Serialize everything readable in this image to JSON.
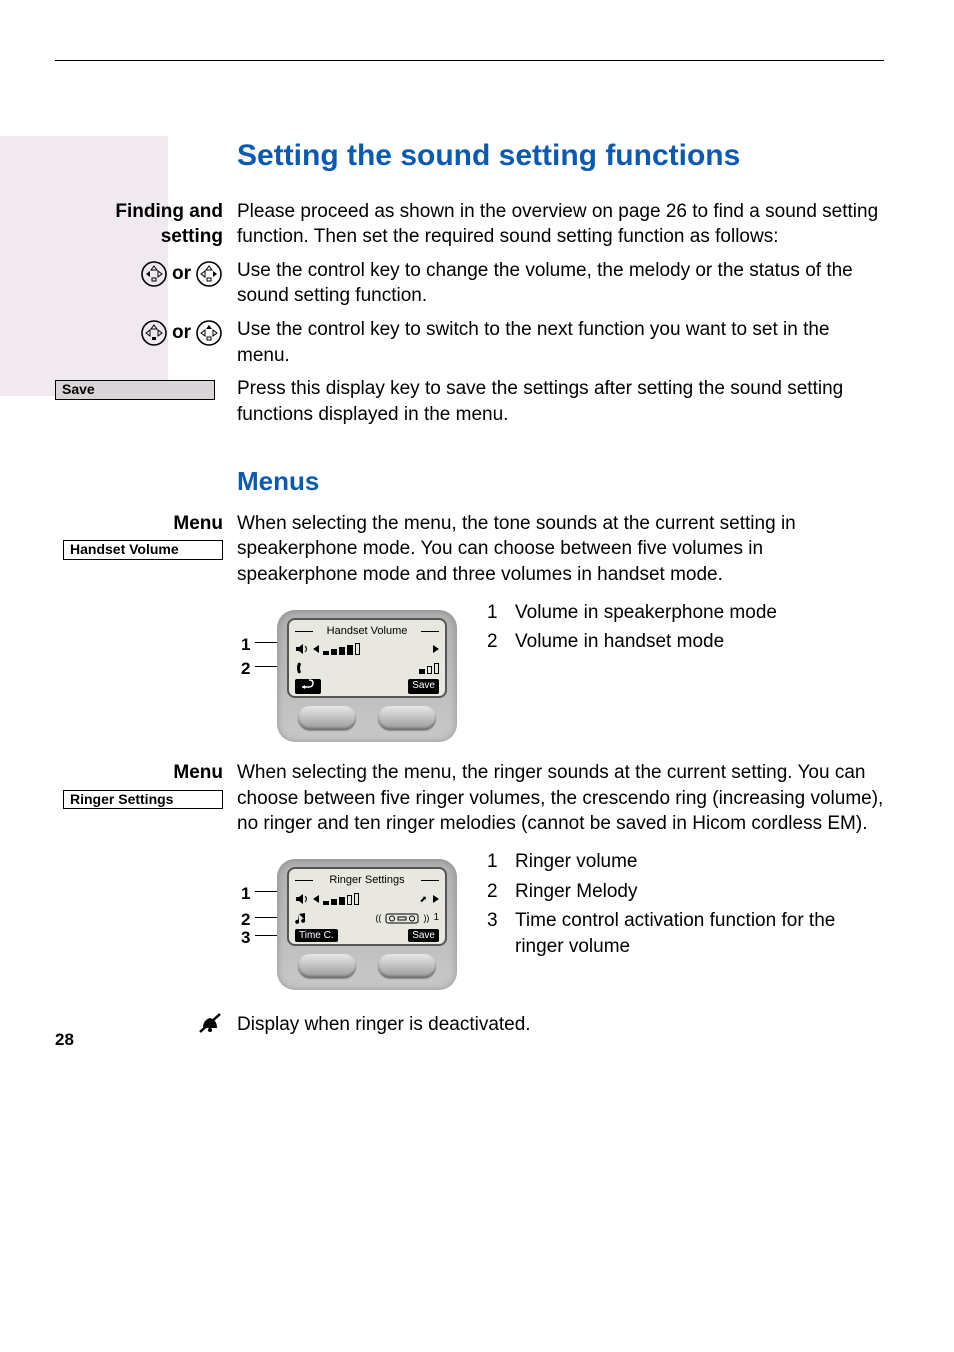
{
  "pageNumber": "28",
  "title": "Setting the sound setting functions",
  "findingLabel": "Finding and setting",
  "or": "or",
  "findingBody": "Please proceed as shown in the overview on page 26 to find a sound setting function. Then set the required sound setting function as follows:",
  "controlBody1": "Use the control key to change the volume, the melody or the status of the sound setting function.",
  "controlBody2": "Use the control key to switch to the next function you want to set in the menu.",
  "saveKey": "Save",
  "saveBody": "Press this display key to save the settings after setting the sound setting functions displayed in the menu.",
  "menusHeading": "Menus",
  "menuLabel": "Menu",
  "handsetVolumeKey": "Handset Volume",
  "handsetVolumeBody": "When selecting the menu, the tone sounds at the current setting in speakerphone mode. You can choose between five volumes in speakerphone mode and three volumes in handset mode.",
  "handsetScreenTitle": "Handset Volume",
  "softSave": "Save",
  "legend1": {
    "n1": "1",
    "t1": "Volume in speakerphone mode",
    "n2": "2",
    "t2": "Volume in handset mode"
  },
  "ringerSettingsKey": "Ringer Settings",
  "ringerBody": "When selecting the menu, the ringer sounds at the current setting. You can choose between five ringer volumes, the crescendo ring (increasing volume), no ringer and ten ringer melodies (cannot be saved in Hicom cordless EM).",
  "ringerScreenTitle": "Ringer Settings",
  "softTimeC": "Time C.",
  "legend2": {
    "n1": "1",
    "t1": "Ringer volume",
    "n2": "2",
    "t2": "Ringer Melody",
    "n3": "3",
    "t3": "Time control activation function for the ringer volume"
  },
  "ringerOffBody": "Display when ringer is deactivated."
}
